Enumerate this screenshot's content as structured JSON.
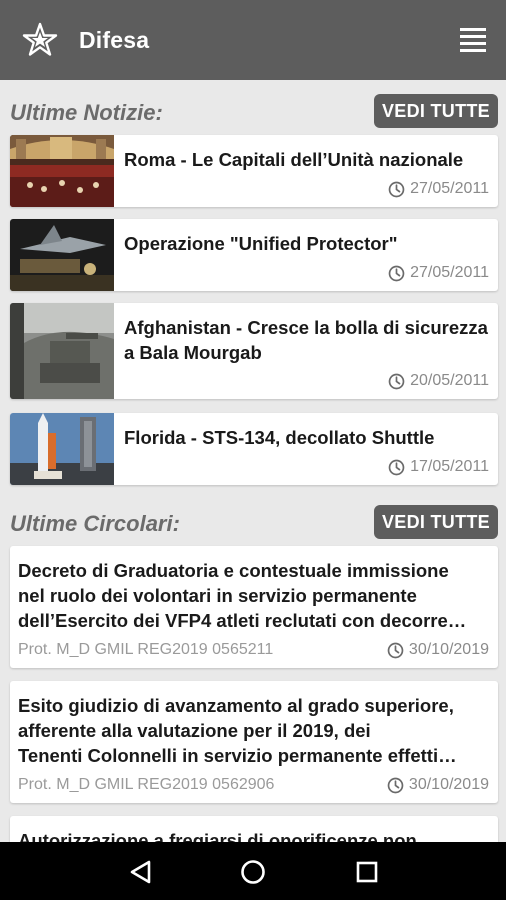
{
  "app": {
    "title": "Difesa"
  },
  "news": {
    "label": "Ultime Notizie:",
    "see_all": "VEDI TUTTE",
    "items": [
      {
        "title": "Roma - Le Capitali dell’Unità nazionale",
        "date": "27/05/2011"
      },
      {
        "title": "Operazione \"Unified Protector\"",
        "date": "27/05/2011"
      },
      {
        "title": "Afghanistan - Cresce la bolla di sicurezza a Bala Mourgab",
        "date": "20/05/2011"
      },
      {
        "title": "Florida - STS-134, decollato Shuttle",
        "date": "17/05/2011"
      }
    ]
  },
  "circolari": {
    "label": "Ultime Circolari:",
    "see_all": "VEDI TUTTE",
    "items": [
      {
        "lines": [
          "Decreto di Graduatoria e contestuale immissione",
          "nel ruolo dei volontari in servizio permanente",
          "dell’Esercito dei VFP4 atleti reclutati con decorre…"
        ],
        "prot": "Prot. M_D GMIL REG2019 0565211",
        "date": "30/10/2019"
      },
      {
        "lines": [
          "Esito giudizio di avanzamento al grado superiore,",
          "afferente alla valutazione per il 2019, dei",
          "Tenenti Colonnelli in servizio permanente effetti…"
        ],
        "prot": "Prot. M_D GMIL REG2019 0562906",
        "date": "30/10/2019"
      },
      {
        "lines": [
          "Autorizzazione a fregiarsi di onorificenze non"
        ]
      }
    ]
  },
  "icons": {
    "logo": "star-emblem-icon",
    "menu": "hamburger-menu-icon",
    "date": "clock-icon",
    "nav_back": "back-triangle-icon",
    "nav_home": "home-circle-icon",
    "nav_recents": "recents-square-icon"
  },
  "colors": {
    "appbar": "#5d5d5d",
    "background": "#e9e9e9",
    "button": "#5d5d5d"
  }
}
